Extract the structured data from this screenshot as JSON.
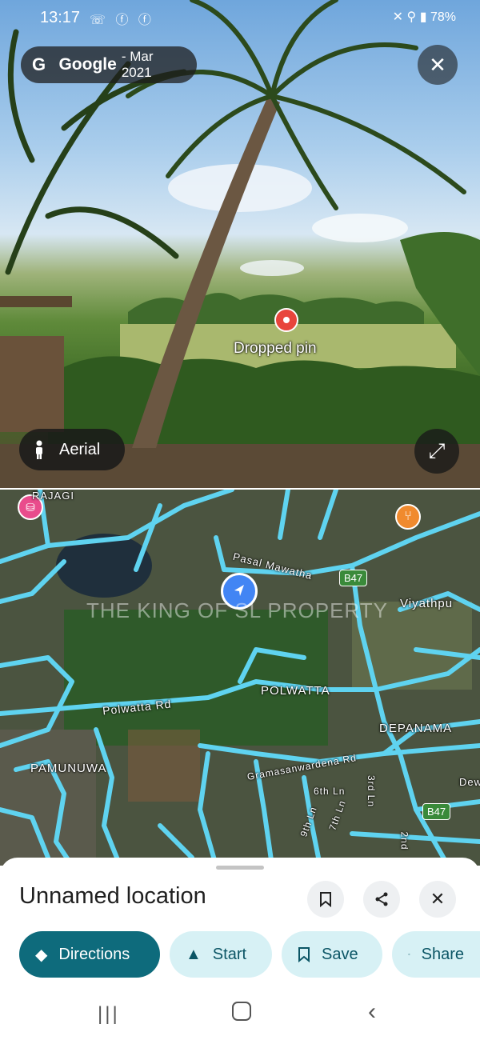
{
  "status_bar": {
    "time": "13:17",
    "left_icons": "☏ ⓕ ⓕ",
    "battery": "78%"
  },
  "street_view": {
    "provider": "Google",
    "date": " - Mar 2021",
    "pin_label": "Dropped pin",
    "layer_toggle_label": "Aerial",
    "close_icon": "close-icon",
    "expand_icon": "expand-icon"
  },
  "map": {
    "labels": {
      "pasal_mawatha": "Pasal Mawatha",
      "polwatta": "POLWATTA",
      "polwatta_rd": "Polwatta Rd",
      "depanama": "DEPANAMA",
      "pamunuwa": "PAMUNUWA",
      "gramasanwardena": "Gramasanwardena Rd",
      "viyathpu": "Viyathpu",
      "sixth_ln": "6th Ln",
      "seventh_ln": "7th Ln",
      "ninth_ln": "9th Ln",
      "third_ln": "3rd Ln",
      "second_ln": "2nd",
      "dew": "Dew",
      "rajagiri": "RAJAGI",
      "route_847a": "B47",
      "route_847b": "B47"
    },
    "watermark": "THE KING OF SL PROPERTY",
    "road_color": "#5fd3f0"
  },
  "sheet": {
    "title": "Unnamed location",
    "actions": {
      "directions": "Directions",
      "start": "Start",
      "save": "Save",
      "share": "Share"
    }
  },
  "colors": {
    "primary_chip": "#0e6b7c",
    "secondary_chip": "#d7f1f5",
    "pin": "#e8453c",
    "location": "#4285f4"
  }
}
